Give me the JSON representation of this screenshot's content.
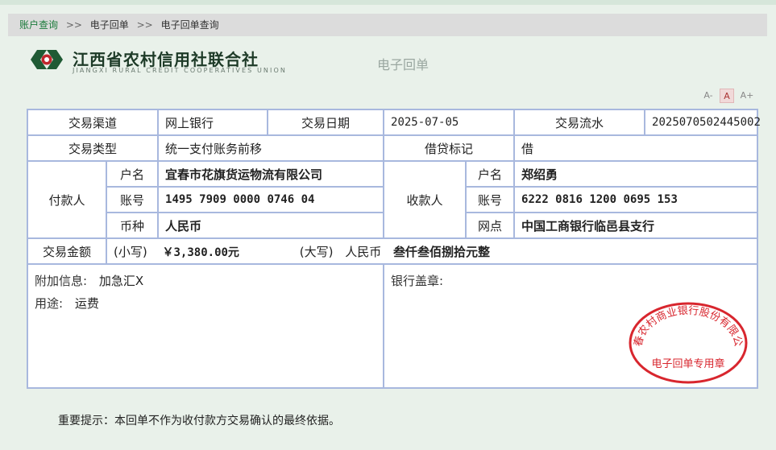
{
  "breadcrumb": {
    "items": [
      "账户查询",
      "电子回单",
      "电子回单查询"
    ],
    "separator": ">>"
  },
  "header": {
    "logo_cn": "江西省农村信用社联合社",
    "logo_en": "JIANGXI RURAL CREDIT COOPERATIVES UNION",
    "receipt_title": "电子回单"
  },
  "font_controls": [
    "A-",
    "A",
    "A+"
  ],
  "receipt": {
    "channel_label": "交易渠道",
    "channel_value": "网上银行",
    "date_label": "交易日期",
    "date_value": "2025-07-05",
    "serial_label": "交易流水",
    "serial_value": "2025070502445002",
    "type_label": "交易类型",
    "type_value": "统一支付账务前移",
    "dc_label": "借贷标记",
    "dc_value": "借",
    "payer_label": "付款人",
    "payee_label": "收款人",
    "name_label": "户名",
    "account_label": "账号",
    "currency_label": "币种",
    "branch_label": "网点",
    "payer_name": "宜春市花旗货运物流有限公司",
    "payer_account": "1495 7909 0000 0746 04",
    "currency_value": "人民币",
    "payee_name": "郑绍勇",
    "payee_account": "6222 0816 1200 0695 153",
    "payee_branch": "中国工商银行临邑县支行",
    "amount_label": "交易金额",
    "amount_small_label": "(小写)",
    "amount_small_value": "￥3,380.00元",
    "amount_big_label": "(大写)",
    "amount_big_currency": "人民币",
    "amount_big_value": "叁仟叁佰捌拾元整",
    "extra_info_label": "附加信息:",
    "extra_info_value": "加急汇X",
    "purpose_label": "用途:",
    "purpose_value": "运费",
    "stamp_label": "银行盖章:"
  },
  "seal": {
    "arc_text": "宜春农村商业银行股份有限公司",
    "center_text": "电子回单专用章",
    "color": "#d8262e"
  },
  "notice": "重要提示：本回单不作为收付款方交易确认的最终依据。"
}
